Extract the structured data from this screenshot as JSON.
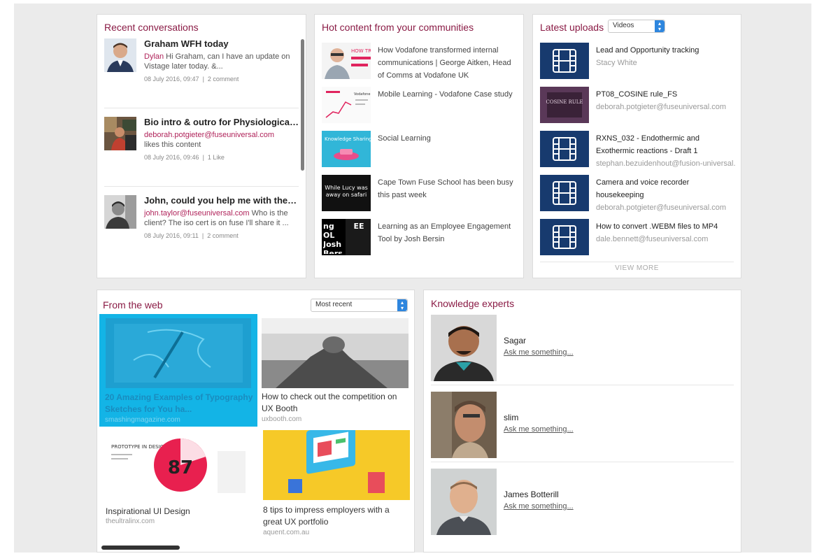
{
  "recent": {
    "title": "Recent conversations",
    "items": [
      {
        "title": "Graham WFH today",
        "user": "Dylan",
        "text": " Hi Graham, can I have an update on Vistage later today. &...",
        "date": "08 July 2016, 09:47",
        "stat": "2 comment"
      },
      {
        "title": "Bio intro & outro for Physiological...",
        "user": "deborah.potgieter@fuseuniversal.com",
        "text": "likes this content",
        "date": "08 July 2016, 09:46",
        "stat": "1 Like"
      },
      {
        "title": "John, could you help me with thes...",
        "user": "john.taylor@fuseuniversal.com",
        "text": " Who is the client? The iso cert is on fuse I'll share it ...",
        "date": "08 July 2016, 09:11",
        "stat": "2 comment"
      }
    ]
  },
  "hot": {
    "title": "Hot content from your communities",
    "items": [
      {
        "text": "How Vodafone transformed internal communications | George Aitken, Head of Comms at Vodafone UK",
        "thumb_text": "HOW TRANSF INTER V"
      },
      {
        "text": "Mobile Learning - Vodafone Case study",
        "thumb_text": "Vodafone"
      },
      {
        "text": "Social Learning",
        "thumb_text": "Knowledge Sharing"
      },
      {
        "text": "Cape Town Fuse School has been busy this past week",
        "thumb_text": "While Lucy was away on safari"
      },
      {
        "text": "Learning as an Employee Engagement Tool by Josh Bersin",
        "thumb_text": "ng EE OL Josh Bers"
      }
    ]
  },
  "uploads": {
    "title": "Latest uploads",
    "filter": "Videos",
    "items": [
      {
        "title": "Lead and Opportunity tracking",
        "sub": "Stacy White",
        "thumb": "film-icon"
      },
      {
        "title": "PT08_COSINE rule_FS",
        "sub": "deborah.potgieter@fuseuniversal.com",
        "thumb": "COSINE RULE"
      },
      {
        "title": "RXNS_032 - Endothermic and Exothermic reactions - Draft 1",
        "sub": "stephan.bezuidenhout@fusion-universal.com",
        "thumb": "film-icon"
      },
      {
        "title": "Camera and voice recorder housekeeping",
        "sub": "deborah.potgieter@fuseuniversal.com",
        "thumb": "film-icon"
      },
      {
        "title": "How to convert .WEBM files to MP4",
        "sub": "dale.bennett@fuseuniversal.com",
        "thumb": "film-icon"
      }
    ],
    "view_more": "VIEW MORE"
  },
  "web": {
    "title": "From the web",
    "sort": "Most recent",
    "items": [
      {
        "title": "20 Amazing Examples of Typography Sketches for You ha...",
        "source": "smashingmagazine.com"
      },
      {
        "title": "How to check out the competition on UX Booth",
        "source": "uxbooth.com"
      },
      {
        "title": "Inspirational UI Design",
        "source": "theultralinx.com",
        "thumb_text": "PROTOTYPE IN DESIGN",
        "thumb_num": "87"
      },
      {
        "title": "8 tips to impress employers with a great UX portfolio",
        "source": "aquent.com.au"
      }
    ]
  },
  "experts": {
    "title": "Knowledge experts",
    "items": [
      {
        "name": "Sagar",
        "ask": "Ask me something..."
      },
      {
        "name": "slim",
        "ask": "Ask me something..."
      },
      {
        "name": "James Botterill",
        "ask": "Ask me something..."
      }
    ]
  },
  "colors": {
    "accent": "#8a1b45",
    "link": "#b0235a",
    "video_thumb": "#173a6e",
    "highlight": "#13b4e6"
  }
}
